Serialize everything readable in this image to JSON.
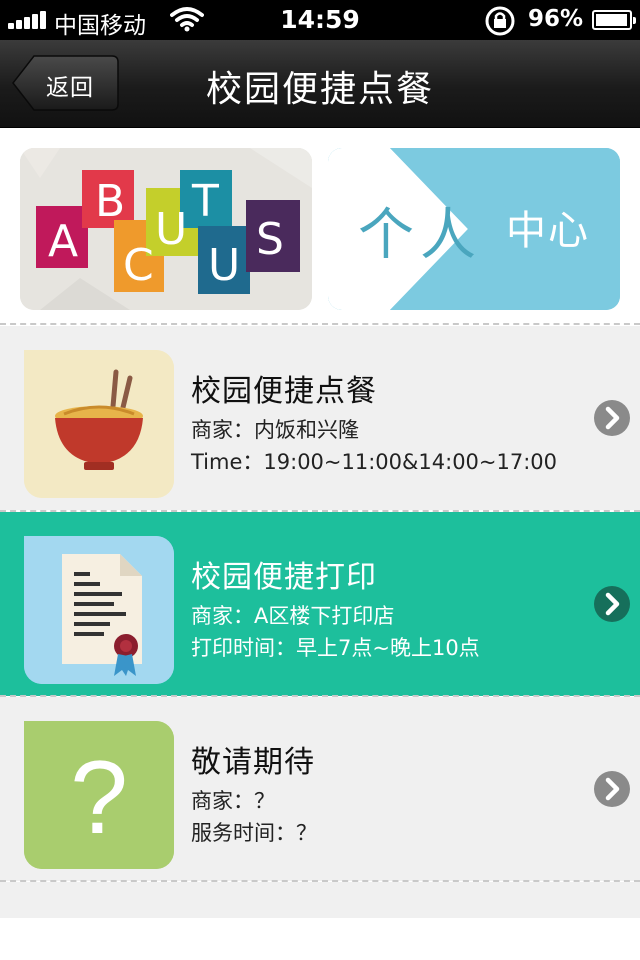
{
  "status_bar": {
    "carrier": "中国移动",
    "time": "14:59",
    "battery_percent": "96%",
    "battery_level": 0.96,
    "signal_bars": 5
  },
  "nav": {
    "back_label": "返回",
    "title": "校园便捷点餐"
  },
  "banner": {
    "left_letters": [
      "A",
      "B",
      "C",
      "U",
      "T",
      "U",
      "S"
    ],
    "right_text_big": "个人",
    "right_text": "中心"
  },
  "items": [
    {
      "title": "校园便捷点餐",
      "line1": "商家：内饭和兴隆",
      "line2": "Time：19:00~11:00&14:00~17:00",
      "icon": "noodle-bowl-icon",
      "active": false
    },
    {
      "title": "校园便捷打印",
      "line1": "商家：A区楼下打印店",
      "line2": "打印时间：早上7点~晚上10点",
      "icon": "document-certificate-icon",
      "active": true
    },
    {
      "title": "敬请期待",
      "line1": "商家：？",
      "line2": "服务时间：？",
      "icon": "question-mark-icon",
      "active": false
    }
  ],
  "colors": {
    "active_row": "#1dbf9c",
    "row": "#f0f0f0",
    "nav_dark": "#1b1b1b"
  }
}
